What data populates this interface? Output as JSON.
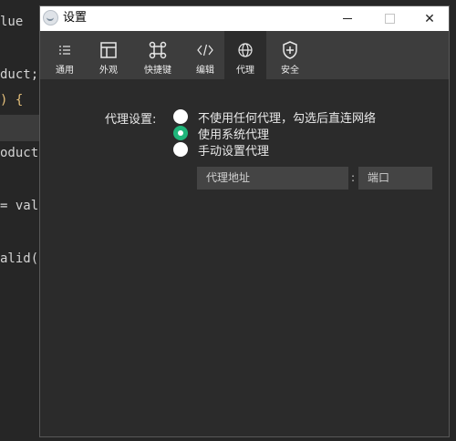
{
  "editor": {
    "lines": [
      {
        "text": "lue",
        "cls": "ident"
      },
      {
        "text": "duct;",
        "cls": "ident"
      },
      {
        "text": ") {",
        "cls": "paren"
      },
      {
        "text": "oduct",
        "cls": "ident"
      },
      {
        "text": "= val",
        "cls": "ident"
      },
      {
        "text": "alid(",
        "cls": "ident"
      }
    ]
  },
  "window": {
    "title": "设置",
    "controls": {
      "minimize": "minimize",
      "maximize": "maximize",
      "close": "✕"
    }
  },
  "toolbar": {
    "tabs": [
      {
        "label": "通用",
        "icon": "list-icon"
      },
      {
        "label": "外观",
        "icon": "window-icon"
      },
      {
        "label": "快捷键",
        "icon": "command-icon"
      },
      {
        "label": "编辑",
        "icon": "code-icon"
      },
      {
        "label": "代理",
        "icon": "globe-icon",
        "active": true
      },
      {
        "label": "安全",
        "icon": "shield-plus-icon"
      }
    ]
  },
  "proxy": {
    "label": "代理设置:",
    "options": [
      {
        "label": "不使用任何代理，勾选后直连网络",
        "checked": false
      },
      {
        "label": "使用系统代理",
        "checked": true
      },
      {
        "label": "手动设置代理",
        "checked": false
      }
    ],
    "address_placeholder": "代理地址",
    "colon": ":",
    "port_placeholder": "端口"
  },
  "colors": {
    "accent": "#1fb57a",
    "toolbar_bg": "#3d3d3d",
    "window_bg": "#2b2b2b"
  }
}
